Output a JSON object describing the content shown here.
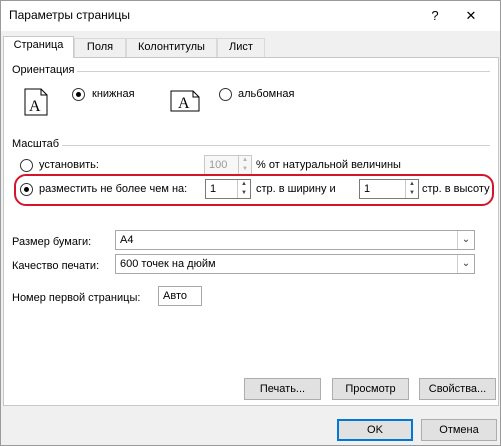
{
  "window": {
    "title": "Параметры страницы",
    "help_glyph": "?",
    "close_glyph": "✕"
  },
  "tabs": [
    {
      "label": "Страница",
      "active": true
    },
    {
      "label": "Поля",
      "active": false
    },
    {
      "label": "Колонтитулы",
      "active": false
    },
    {
      "label": "Лист",
      "active": false
    }
  ],
  "orientation": {
    "group_label": "Ориентация",
    "portrait_label": "книжная",
    "landscape_label": "альбомная",
    "selected": "portrait",
    "icon_letter": "A"
  },
  "scaling": {
    "group_label": "Масштаб",
    "adjust_to_label": "установить:",
    "adjust_to_value": "100",
    "adjust_to_suffix": "% от натуральной величины",
    "fit_to_label": "разместить не более чем на:",
    "fit_wide_value": "1",
    "fit_wide_suffix": "стр. в ширину и",
    "fit_tall_value": "1",
    "fit_tall_suffix": "стр. в высоту",
    "selected": "fit_to"
  },
  "paper_size": {
    "label": "Размер бумаги:",
    "value": "A4"
  },
  "print_quality": {
    "label": "Качество печати:",
    "value": "600 точек на дюйм"
  },
  "first_page_number": {
    "label": "Номер первой страницы:",
    "value": "Авто"
  },
  "buttons": {
    "print": "Печать...",
    "preview": "Просмотр",
    "properties": "Свойства...",
    "ok": "OK",
    "cancel": "Отмена"
  },
  "colors": {
    "highlight": "#d4142a",
    "default_button": "#0078d7"
  }
}
